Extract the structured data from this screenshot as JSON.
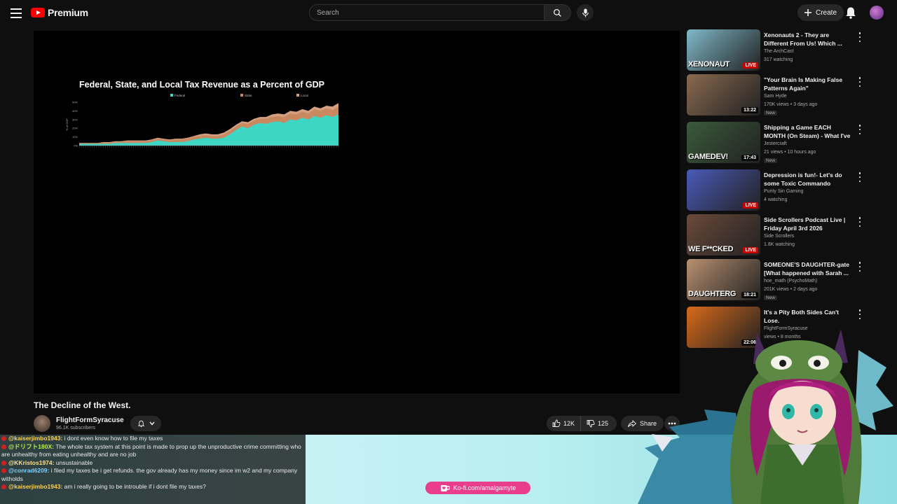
{
  "header": {
    "logo_text": "Premium",
    "search_placeholder": "Search",
    "create_label": "Create"
  },
  "video": {
    "title": "The Decline of the West.",
    "channel_name": "FlightFormSyracuse",
    "channel_subs": "96.1K subscribers",
    "likes": "12K",
    "dislikes": "125",
    "share_label": "Share"
  },
  "chart_data": {
    "type": "area",
    "title": "Federal, State, and Local Tax Revenue as a Percent of GDP",
    "legend": [
      "Federal",
      "State",
      "Local"
    ],
    "legend_position": "top",
    "ylabel": "% of GDP",
    "y_ticks": [
      "50%",
      "40%",
      "30%",
      "20%",
      "10%",
      "0%"
    ],
    "ylim": [
      0,
      50
    ],
    "colors": {
      "Federal": "#3dd6c5",
      "State": "#c88960",
      "Local": "#d4a080"
    },
    "series": [
      {
        "name": "Federal",
        "values": [
          2,
          2,
          2,
          2,
          2,
          2,
          3,
          3,
          3,
          3,
          3,
          3,
          4,
          6,
          5,
          4,
          4,
          4,
          5,
          7,
          8,
          9,
          8,
          8,
          9,
          13,
          18,
          22,
          20,
          24,
          26,
          25,
          27,
          28,
          26,
          30,
          29,
          32,
          30,
          34,
          32,
          35,
          33,
          36
        ]
      },
      {
        "name": "State",
        "values": [
          1,
          1,
          1,
          1,
          1,
          1,
          1,
          1,
          2,
          2,
          2,
          2,
          2,
          2,
          2,
          2,
          3,
          3,
          3,
          3,
          3,
          3,
          3,
          3,
          4,
          4,
          4,
          4,
          5,
          5,
          5,
          6,
          6,
          6,
          7,
          7,
          7,
          7,
          7,
          8,
          8,
          8,
          8,
          9
        ]
      },
      {
        "name": "Local",
        "values": [
          0,
          0,
          0,
          0,
          1,
          1,
          1,
          1,
          1,
          1,
          1,
          1,
          1,
          1,
          1,
          1,
          1,
          1,
          1,
          1,
          2,
          2,
          2,
          2,
          2,
          2,
          2,
          2,
          2,
          2,
          2,
          2,
          3,
          3,
          3,
          3,
          3,
          3,
          3,
          3,
          3,
          3,
          4,
          4
        ]
      }
    ]
  },
  "recommendations": [
    {
      "title": "Xenonauts 2 - They are Different From Us! Which ...",
      "channel": "The ArchCast",
      "meta": "317 watching",
      "badge": "LIVE",
      "badge_type": "live",
      "thumb_text": "XENONAUT",
      "thumb_bg": "#7fb8c8",
      "new": ""
    },
    {
      "title": "\"Your Brain Is Making False Patterns Again\"",
      "channel": "Sam Hyde",
      "meta": "170K views • 3 days ago",
      "badge": "13:22",
      "badge_type": "dur",
      "thumb_text": "",
      "thumb_bg": "#8a6a50",
      "new": "New"
    },
    {
      "title": "Shipping a Game EACH MONTH (On Steam) - What I've learned...",
      "channel": "Jestercraft",
      "meta": "21 views • 10 hours ago",
      "badge": "17:43",
      "badge_type": "dur",
      "thumb_text": "GAMEDEV!",
      "thumb_bg": "#3a5a3a",
      "new": "New"
    },
    {
      "title": "Depression is fun!- Let's do some Toxic Commando",
      "channel": "Purity Sin Gaming",
      "meta": "4 watching",
      "badge": "LIVE",
      "badge_type": "live",
      "thumb_text": "",
      "thumb_bg": "#4a5ab8",
      "new": ""
    },
    {
      "title": "Side Scrollers Podcast Live | Friday April 3rd 2026",
      "channel": "Side Scrollers",
      "meta": "1.8K watching",
      "badge": "LIVE",
      "badge_type": "live",
      "thumb_text": "WE F**CKED",
      "thumb_bg": "#6a4a3a",
      "new": ""
    },
    {
      "title": "SOMEONE'S DAUGHTER-gate [What happened with Sarah ...",
      "channel": "hoe_math (PsychoMath)",
      "meta": "201K views • 2 days ago",
      "badge": "18:21",
      "badge_type": "dur",
      "thumb_text": "DAUGHTERG",
      "thumb_bg": "#b89070",
      "new": "New"
    },
    {
      "title": "It's a Pity Both Sides Can't Lose.",
      "channel": "FlightFormSyracuse",
      "meta": "views • 8 months",
      "badge": "22:06",
      "badge_type": "dur",
      "thumb_text": "",
      "thumb_bg": "#d86a1a",
      "new": ""
    }
  ],
  "chat": [
    {
      "user": "@kaiserjimbo1943:",
      "text": "i dont even know how to file my taxes",
      "style": "a"
    },
    {
      "user": "@ドリフト180X:",
      "text": "The whole tax system at this point is made to prop up the unproductive crime committing who are unhealthy from eating unhealthy and are no job",
      "style": "b"
    },
    {
      "user": "@KKristos1974:",
      "text": "unsustainable",
      "style": "c"
    },
    {
      "user": "@conrad6209:",
      "text": "i filed my taxes be i get refunds. the gov already has my money since im w2 and my company witholds",
      "style": "d"
    },
    {
      "user": "@kaiserjimbo1943:",
      "text": "am i really going to be introuble if i dont file my taxes?",
      "style": "a"
    }
  ],
  "overlay": {
    "kofi_text": "Ko-fi.com/amalgamyte"
  },
  "colors": {
    "background": "#0f0f0f",
    "brand_red": "#ff0000",
    "federal": "#3dd6c5",
    "state": "#c88960",
    "kofi": "#e83e8c"
  }
}
